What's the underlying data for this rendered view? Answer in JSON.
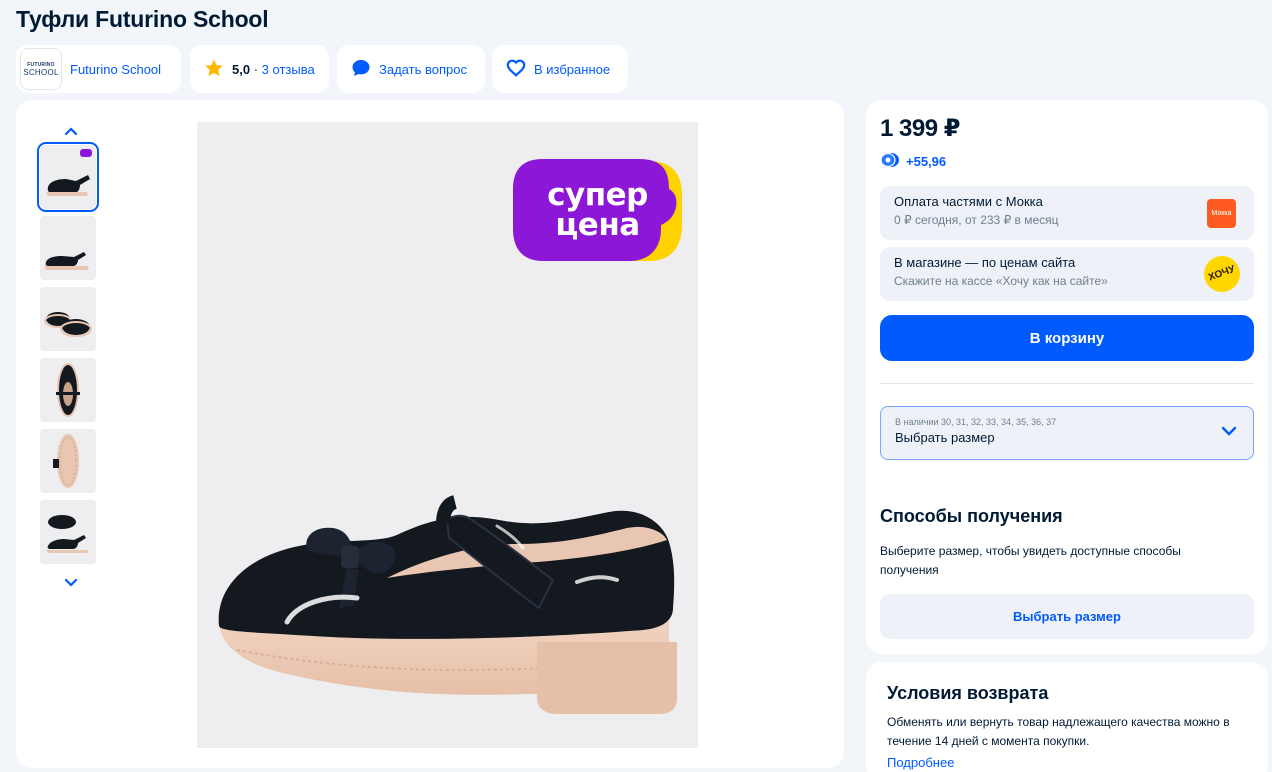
{
  "product": {
    "title": "Туфли Futurino School"
  },
  "header_bar": {
    "brand_logo_line1": "FUTURINO",
    "brand_logo_line2": "SCHOOL",
    "brand_name": "Futurino School",
    "rating": "5,0",
    "rating_separator": "·",
    "reviews": "3 отзыва",
    "ask_question": "Задать вопрос",
    "favorites": "В избранное",
    "star_color": "#ffb800",
    "accent_color": "#005bff"
  },
  "gallery": {
    "badge_line1": "супер",
    "badge_line2": "цена",
    "badge_colors": [
      "#8c17d6",
      "#ffd300"
    ],
    "thumbnails": [
      "shoe-side-with-badge",
      "shoe-side",
      "shoe-pair",
      "shoe-top",
      "shoe-sole",
      "shoe-pair-angle"
    ],
    "active_thumbnail": 1
  },
  "buy": {
    "price": "1 399 ₽",
    "bonus": "+55,96",
    "installments_title": "Оплата частями с Мокка",
    "installments_sub": "0 ₽ сегодня, от 233 ₽ в месяц",
    "installments_logo": "Мокка",
    "store_title": "В магазине — по ценам сайта",
    "store_sub": "Скажите на кассе «Хочу как на сайте»",
    "store_logo": "ХОЧУ",
    "cart_button": "В корзину",
    "sizes_available": "В наличии 30, 31, 32, 33, 34, 35, 36, 37",
    "choose_size": "Выбрать размер"
  },
  "delivery": {
    "title": "Способы получения",
    "note": "Выберите размер, чтобы увидеть доступные способы получения",
    "button": "Выбрать размер"
  },
  "returns": {
    "title": "Условия возврата",
    "note": "Обменять или вернуть товар надлежащего качества можно в течение 14 дней с момента покупки.",
    "link": "Подробнее"
  }
}
